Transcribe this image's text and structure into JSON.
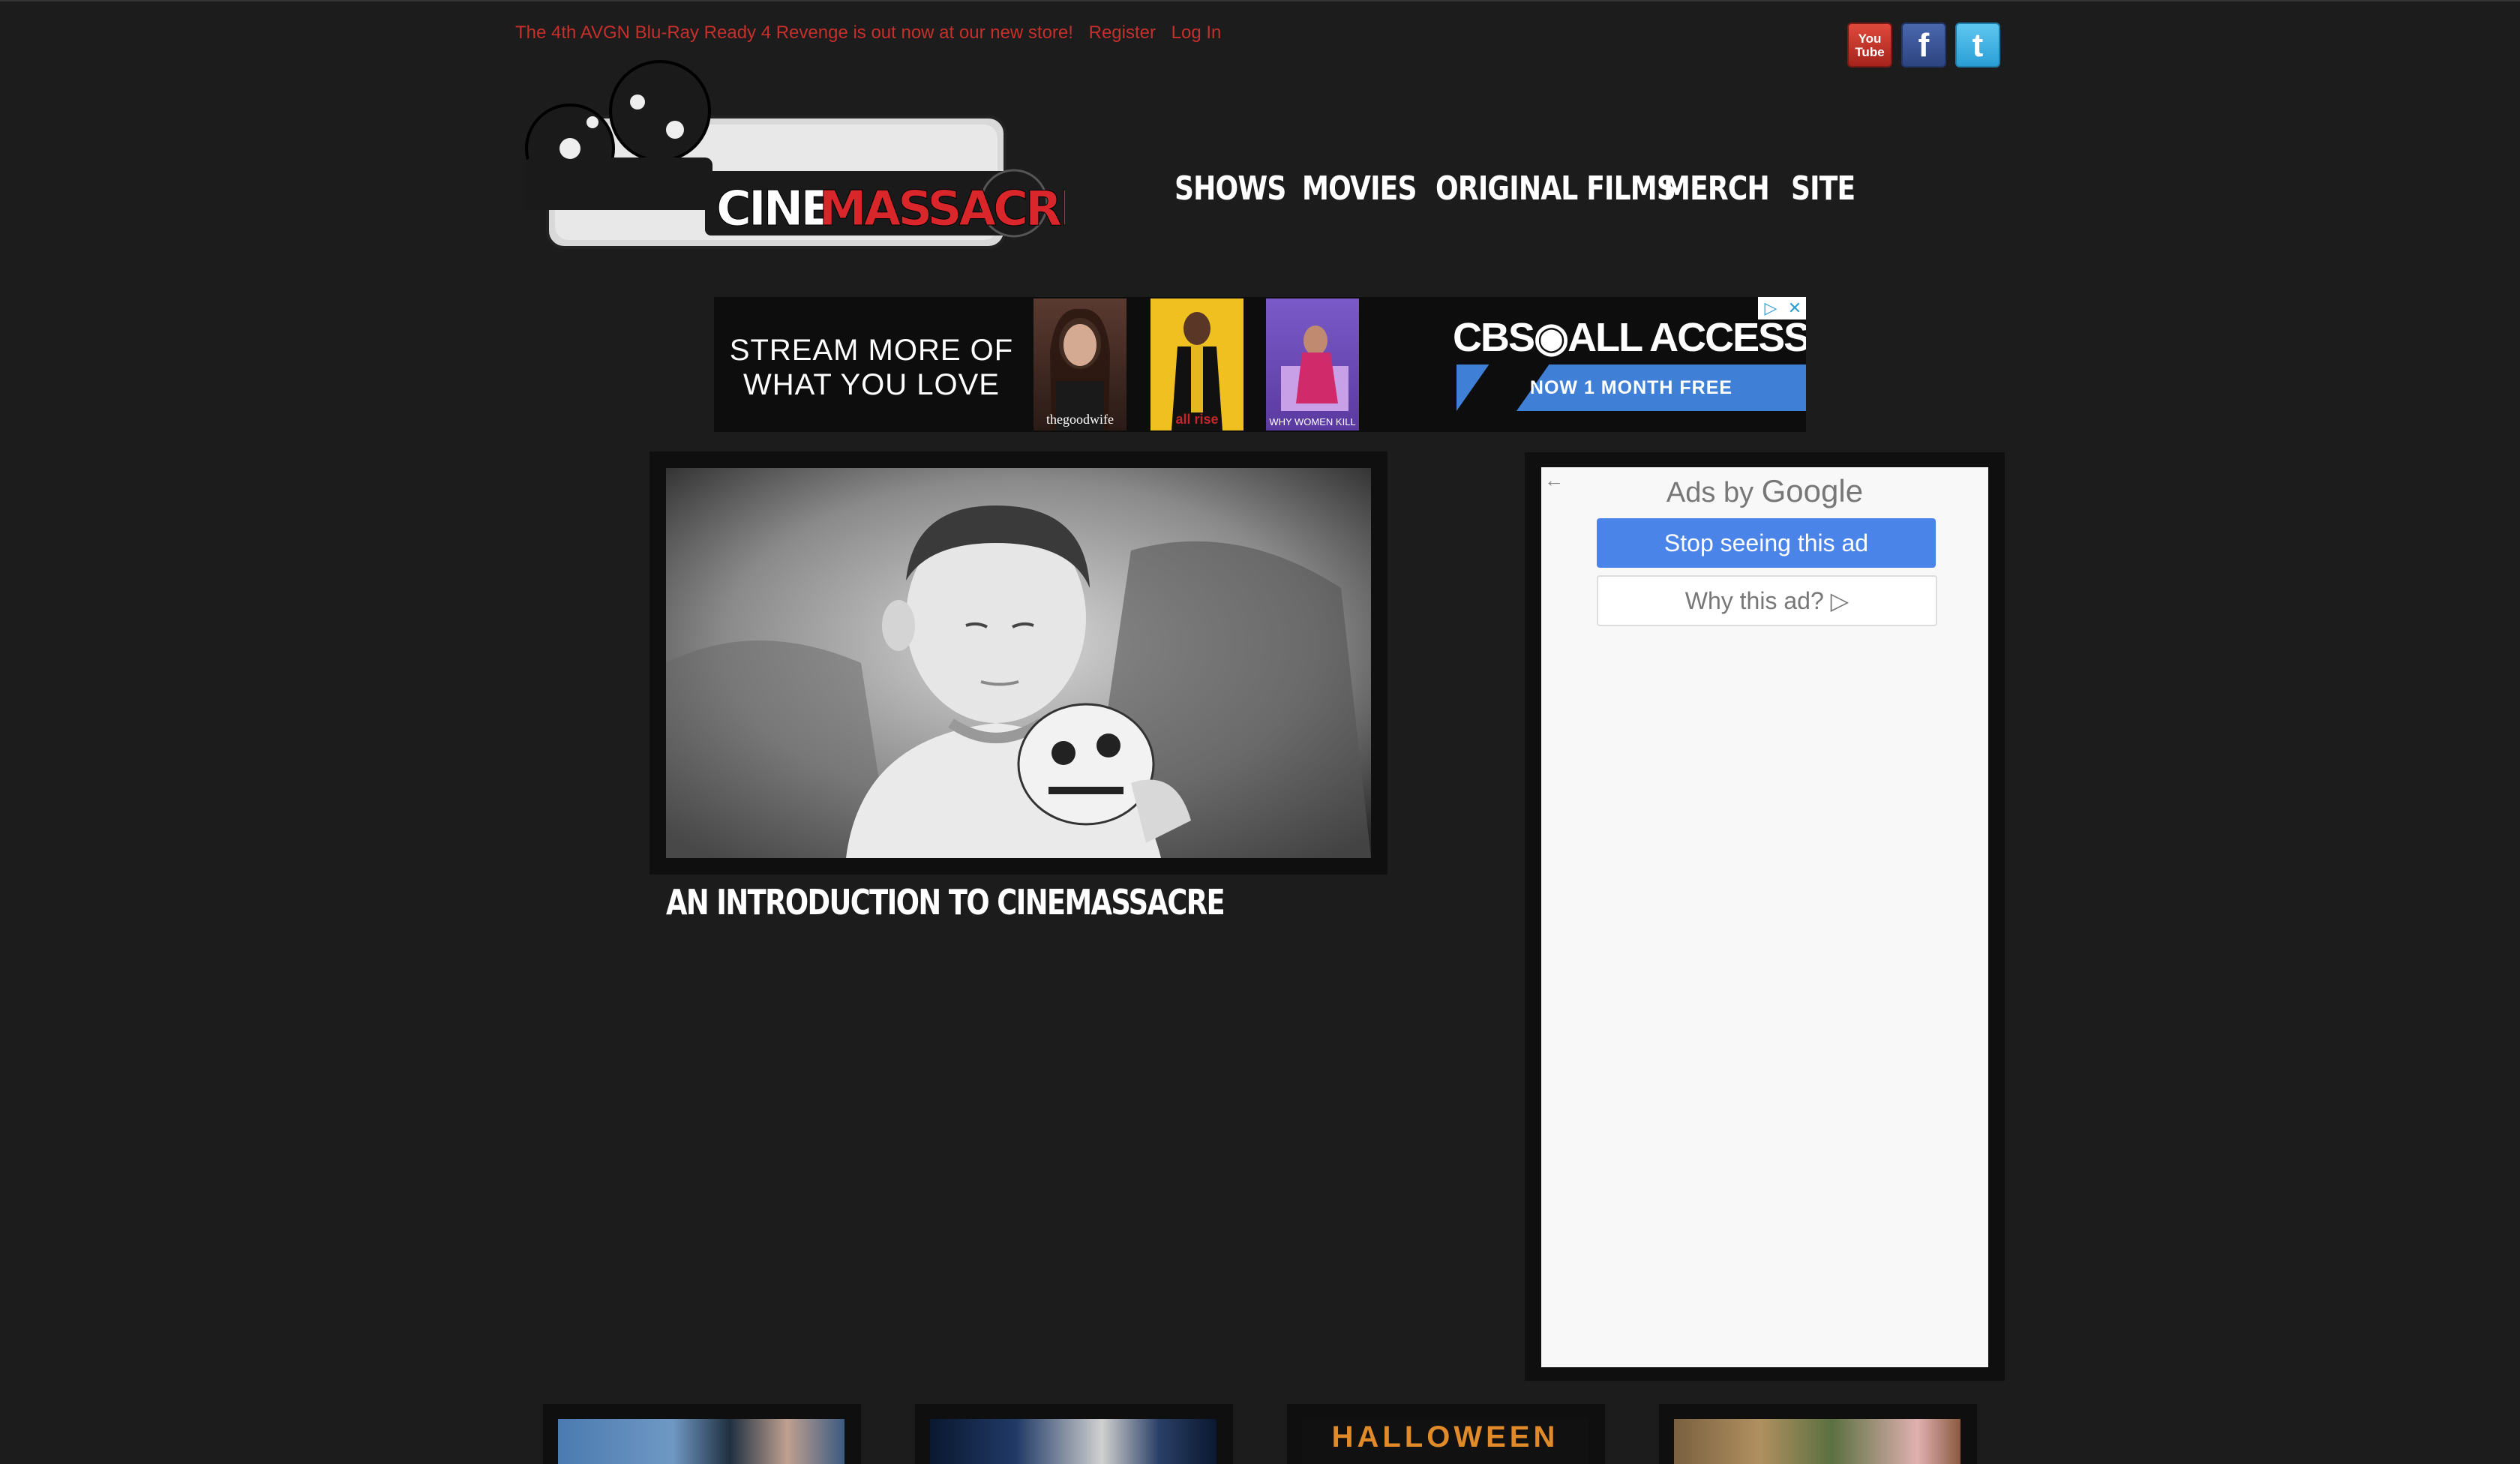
{
  "topbar": {
    "announcement": "The 4th AVGN Blu-Ray Ready 4 Revenge is out now at our new store!",
    "register": "Register",
    "login": "Log In"
  },
  "social": {
    "youtube_label": "You Tube",
    "facebook_glyph": "f",
    "twitter_glyph": "t"
  },
  "logo": {
    "text_left": "CINE",
    "text_right": "MASSACRE"
  },
  "nav": {
    "items": [
      {
        "label": "SHOWS"
      },
      {
        "label": "MOVIES"
      },
      {
        "label": "ORIGINAL FILMS"
      },
      {
        "label": "MERCH"
      },
      {
        "label": "SITE"
      }
    ]
  },
  "banner_ad": {
    "headline_line1": "STREAM MORE OF",
    "headline_line2": "WHAT YOU LOVE",
    "posters": [
      {
        "caption": "thegoodwife"
      },
      {
        "caption": "all rise"
      },
      {
        "caption": "WHY WOMEN KILL"
      }
    ],
    "brand": "CBS◉ALL ACCESS",
    "cta": "NOW 1 MONTH FREE"
  },
  "feature": {
    "title": "AN INTRODUCTION TO CINEMASSACRE"
  },
  "side_ad": {
    "ads_by": "Ads by",
    "google": "Google",
    "stop_button": "Stop seeing this ad",
    "why_button": "Why this ad? ▷"
  },
  "thumbnails": [
    {
      "text": ""
    },
    {
      "text": ""
    },
    {
      "text": "HALLOWEEN"
    },
    {
      "text": ""
    }
  ],
  "colors": {
    "background": "#1c1c1c",
    "accent_red": "#c6302c",
    "google_blue": "#4a84e8",
    "cbs_blue": "#3f7fd6"
  }
}
